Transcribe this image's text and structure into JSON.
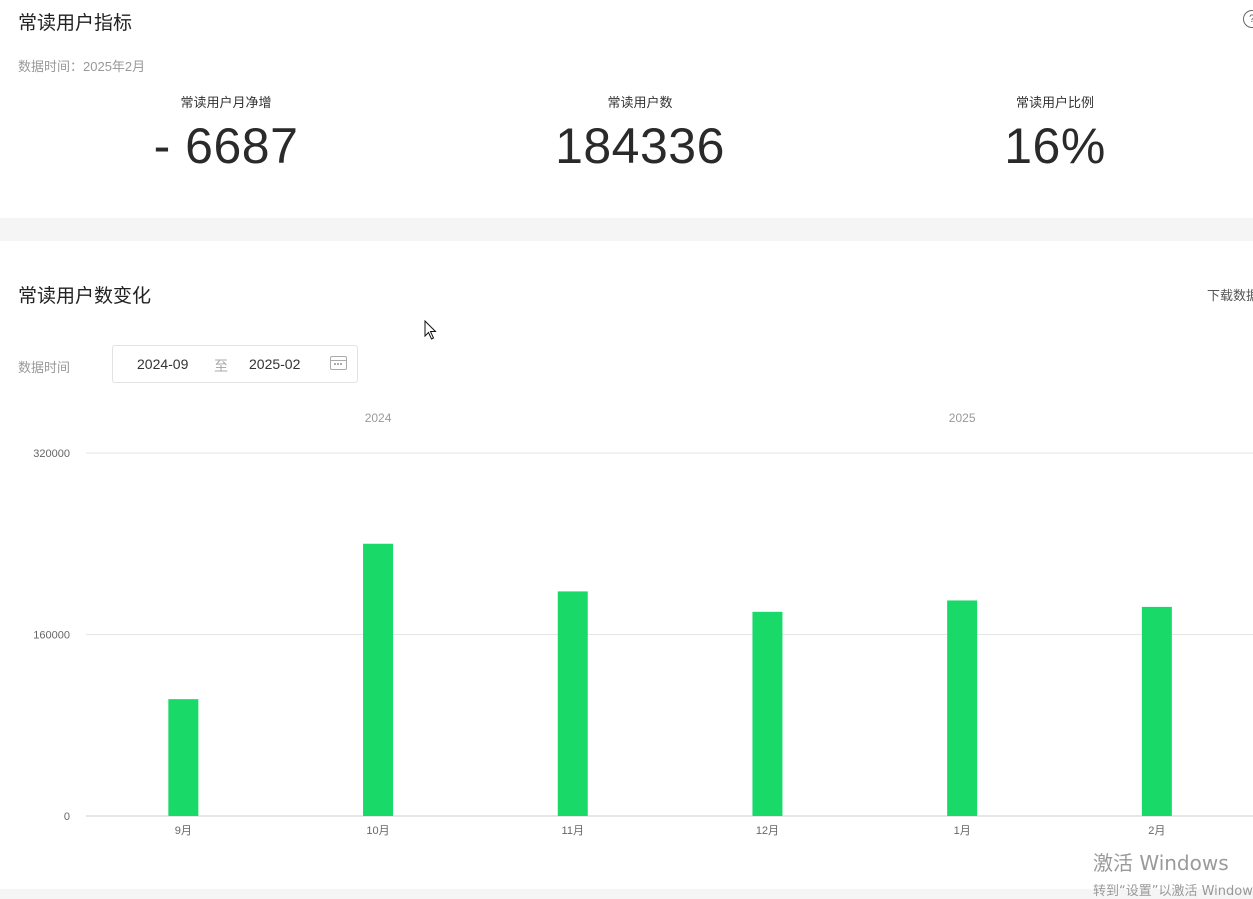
{
  "indicators": {
    "title": "常读用户指标",
    "data_time": "数据时间：2025年2月",
    "metrics": [
      {
        "label": "常读用户月净增",
        "value": "- 6687"
      },
      {
        "label": "常读用户数",
        "value": "184336"
      },
      {
        "label": "常读用户比例",
        "value": "16%"
      }
    ]
  },
  "trend": {
    "title": "常读用户数变化",
    "download_label": "下载数据",
    "date_label": "数据时间",
    "date_start": "2024-09",
    "date_sep": "至",
    "date_end": "2025-02"
  },
  "chart_data": {
    "type": "bar",
    "categories": [
      "9月",
      "10月",
      "11月",
      "12月",
      "1月",
      "2月"
    ],
    "values": [
      103000,
      240000,
      198000,
      180000,
      190000,
      184336
    ],
    "year_labels": [
      {
        "text": "2024",
        "category": "10月"
      },
      {
        "text": "2025",
        "category": "1月"
      }
    ],
    "yticks": [
      0,
      160000,
      320000
    ],
    "ylim": [
      0,
      320000
    ],
    "bar_color": "#19d969",
    "grid": true
  },
  "watermark": {
    "line1": "激活 Windows",
    "line2": "转到“设置”以激活 Windows。"
  }
}
